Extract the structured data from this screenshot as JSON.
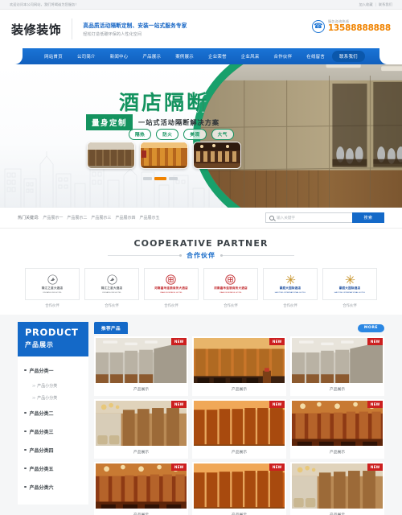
{
  "topbar": {
    "notice": "欢迎访问本公司网站，我们将竭诚为您服务！",
    "links": [
      "加入收藏",
      "联系我们"
    ],
    "separator": "|"
  },
  "header": {
    "logo": "装修装饰",
    "slogan_main": "高品质活动隔断定制、安装一站式服务专家",
    "slogan_sub": "轻松打造低碳环保的人性化空间",
    "tel_label": "服务咨询热线",
    "tel_number": "13588888888",
    "phone_icon": "phone-icon"
  },
  "nav": {
    "items": [
      {
        "label": "网站首页",
        "active": false
      },
      {
        "label": "公司简介",
        "active": false
      },
      {
        "label": "新闻中心",
        "active": false
      },
      {
        "label": "产品展示",
        "active": false
      },
      {
        "label": "案例展示",
        "active": false
      },
      {
        "label": "企业荣誉",
        "active": false
      },
      {
        "label": "企业风采",
        "active": false
      },
      {
        "label": "合作伙伴",
        "active": false
      },
      {
        "label": "在线留言",
        "active": false
      },
      {
        "label": "联系我们",
        "active": true
      }
    ]
  },
  "banner": {
    "title": "酒店隔断",
    "badge": "量身定制",
    "subtitle": "一站式活动隔断解决方案",
    "tags": [
      "隔热",
      "防火",
      "美观",
      "大气"
    ],
    "thumbs": [
      "酒店隔断图一",
      "酒店隔断图二",
      "酒店隔断图三"
    ],
    "slides": 3,
    "active_slide": 1,
    "accent_green": "#14935f",
    "accent_orange": "#f08300"
  },
  "search": {
    "keywords_label": "热门关键词:",
    "keywords": [
      "产品展示一",
      "产品展示二",
      "产品展示三",
      "产品展示四",
      "产品展示五"
    ],
    "placeholder": "输入关键字",
    "button": "搜索",
    "icon": "search-icon"
  },
  "partner": {
    "title_en": "COOPERATIVE PARTNER",
    "title_cn": "合作伙伴",
    "items": [
      {
        "cn": "锦江之星大酒店",
        "en": "JINJIANG INN HOTEL",
        "color": "#6b6f74",
        "caption": "合作伙伴"
      },
      {
        "cn": "锦江之星大酒店",
        "en": "JINJIANG INN HOTEL",
        "color": "#6b6f74",
        "caption": "合作伙伴"
      },
      {
        "cn": "河南嘉禾连锁商务大酒店",
        "en": "JIAHE BUSINESS HOTEL",
        "color": "#c0262a",
        "caption": "合作伙伴"
      },
      {
        "cn": "河南嘉禾连锁商务大酒店",
        "en": "JIAHE BUSINESS HOTEL",
        "color": "#c0262a",
        "caption": "合作伙伴"
      },
      {
        "cn": "豪庭大国际酒店",
        "en": "HAOTING INTERNATIONAL HOTEL",
        "color": "#1e4fa0",
        "caption": "合作伙伴"
      },
      {
        "cn": "豪庭大国际酒店",
        "en": "HAOTING INTERNATIONAL HOTEL",
        "color": "#1e4fa0",
        "caption": "合作伙伴"
      }
    ]
  },
  "product": {
    "side_title_en": "PRODUCT",
    "side_title_cn": "产品展示",
    "categories": [
      {
        "label": "产品分类一",
        "subs": [
          "产品小分类",
          "产品小分类"
        ]
      },
      {
        "label": "产品分类二",
        "subs": []
      },
      {
        "label": "产品分类三",
        "subs": []
      },
      {
        "label": "产品分类四",
        "subs": []
      },
      {
        "label": "产品分类五",
        "subs": []
      },
      {
        "label": "产品分类六",
        "subs": []
      }
    ],
    "sub_arrow": ">>",
    "tab_label": "推荐产品",
    "more_label": "MORE",
    "badge": "NEW",
    "items": [
      {
        "caption": "产品展示",
        "style": "hall-grey"
      },
      {
        "caption": "产品展示",
        "style": "conference-warm"
      },
      {
        "caption": "产品展示",
        "style": "hall-grey"
      },
      {
        "caption": "产品展示",
        "style": "lounge-wood"
      },
      {
        "caption": "产品展示",
        "style": "corridor-orange"
      },
      {
        "caption": "产品展示",
        "style": "banquet-red"
      },
      {
        "caption": "产品展示",
        "style": "banquet-red"
      },
      {
        "caption": "产品展示",
        "style": "corridor-orange"
      },
      {
        "caption": "产品展示",
        "style": "lounge-wood"
      }
    ]
  }
}
